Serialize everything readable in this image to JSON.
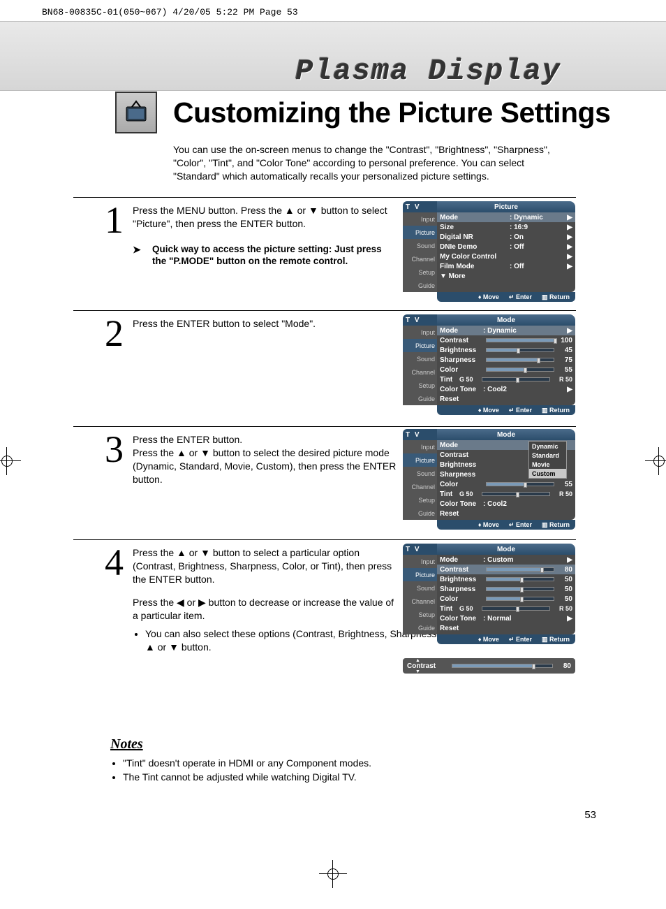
{
  "print_header": "BN68-00835C-01(050~067)  4/20/05  5:22 PM  Page 53",
  "display_title": "Plasma Display",
  "page_title": "Customizing the Picture Settings",
  "intro": "You can use the on-screen menus to change the \"Contrast\", \"Brightness\", \"Sharpness\", \"Color\", \"Tint\", and \"Color Tone\" according to personal preference. You can select \"Standard\" which automatically recalls your personalized picture settings.",
  "steps": {
    "s1": {
      "num": "1",
      "text": "Press the MENU button. Press the ▲ or ▼ button to select \"Picture\", then press the ENTER button.",
      "tip": "Quick way to access the picture setting: Just press the \"P.MODE\" button on the remote control."
    },
    "s2": {
      "num": "2",
      "text": "Press the ENTER button to select \"Mode\"."
    },
    "s3": {
      "num": "3",
      "text": "Press the ENTER button.\nPress the ▲ or ▼ button to select the desired picture mode (Dynamic, Standard, Movie, Custom), then press the ENTER button."
    },
    "s4": {
      "num": "4",
      "text": "Press the ▲ or ▼ button to select a particular option (Contrast, Brightness, Sharpness, Color, or Tint), then press the ENTER button.",
      "text2": "Press the ◀ or ▶ button to decrease or increase the value of a particular item.",
      "bullet": "You can also select these options (Contrast, Brightness, Sharpness, Color, or Tint) by pressing the ▲ or ▼ button."
    }
  },
  "osd_common": {
    "tv": "T V",
    "side": [
      "Input",
      "Picture",
      "Sound",
      "Channel",
      "Setup",
      "Guide"
    ],
    "footer_move": "Move",
    "footer_enter": "Enter",
    "footer_return": "Return"
  },
  "osd1": {
    "title": "Picture",
    "rows": [
      {
        "l": "Mode",
        "v": ": Dynamic",
        "a": "▶"
      },
      {
        "l": "Size",
        "v": ": 16:9",
        "a": "▶"
      },
      {
        "l": "Digital NR",
        "v": ": On",
        "a": "▶"
      },
      {
        "l": "DNIe Demo",
        "v": ": Off",
        "a": "▶"
      },
      {
        "l": "My Color Control",
        "v": "",
        "a": "▶"
      },
      {
        "l": "Film Mode",
        "v": ": Off",
        "a": "▶"
      },
      {
        "l": "▼ More",
        "v": "",
        "a": ""
      }
    ]
  },
  "osd2": {
    "title": "Mode",
    "mode_value": ": Dynamic",
    "contrast": 100,
    "brightness": 45,
    "sharpness": 75,
    "color": 55,
    "tint_l": "G 50",
    "tint_r": "R 50",
    "color_tone": ": Cool2",
    "labels": {
      "mode": "Mode",
      "contrast": "Contrast",
      "brightness": "Brightness",
      "sharpness": "Sharpness",
      "color": "Color",
      "tint": "Tint",
      "color_tone": "Color Tone",
      "reset": "Reset"
    }
  },
  "osd3": {
    "title": "Mode",
    "dropdown": [
      "Dynamic",
      "Standard",
      "Movie",
      "Custom"
    ],
    "dropdown_sel": "Custom",
    "color": 55,
    "tint_l": "G 50",
    "tint_r": "R 50",
    "color_tone": ": Cool2",
    "labels": {
      "mode": "Mode",
      "contrast": "Contrast",
      "brightness": "Brightness",
      "sharpness": "Sharpness",
      "color": "Color",
      "tint": "Tint",
      "color_tone": "Color Tone",
      "reset": "Reset"
    }
  },
  "osd4": {
    "title": "Mode",
    "mode_value": ": Custom",
    "contrast": 80,
    "brightness": 50,
    "sharpness": 50,
    "color": 50,
    "tint_l": "G 50",
    "tint_r": "R 50",
    "color_tone": ": Normal",
    "labels": {
      "mode": "Mode",
      "contrast": "Contrast",
      "brightness": "Brightness",
      "sharpness": "Sharpness",
      "color": "Color",
      "tint": "Tint",
      "color_tone": "Color Tone",
      "reset": "Reset"
    }
  },
  "contrast_bar": {
    "label": "Contrast",
    "value": 80
  },
  "notes": {
    "heading": "Notes",
    "items": [
      "\"Tint\" doesn't operate in HDMI or any Component modes.",
      "The Tint cannot be adjusted while watching Digital TV."
    ]
  },
  "page_number": "53"
}
